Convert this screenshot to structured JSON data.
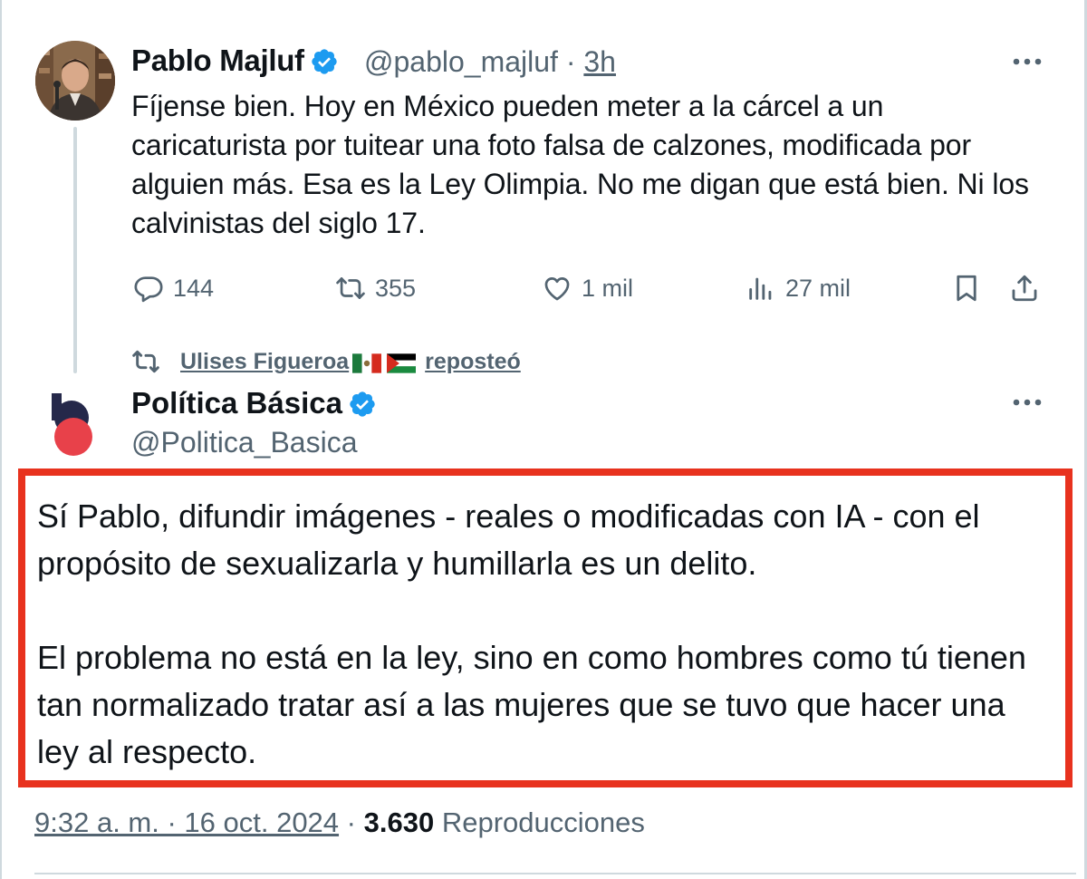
{
  "tweet1": {
    "display_name": "Pablo Majluf",
    "handle": "@pablo_majluf",
    "separator": "·",
    "time": "3h",
    "text": "Fíjense bien. Hoy en México pueden meter a la cárcel a un caricaturista por tuitear una foto falsa de calzones, modificada por alguien más. Esa es la Ley Olimpia. No me digan que está bien. Ni los calvinistas del siglo 17.",
    "replies": "144",
    "reposts": "355",
    "likes": "1 mil",
    "views": "27 mil"
  },
  "repost_note": {
    "user": "Ulises Figueroa",
    "action": "reposteó",
    "flags": [
      "mexico-flag",
      "palestine-flag"
    ]
  },
  "tweet2": {
    "display_name": "Política Básica",
    "handle": "@Politica_Basica",
    "paragraph1": "Sí Pablo, difundir imágenes - reales o modificadas con IA - con el propósito de sexualizarla y humillarla es un delito.",
    "paragraph2": "El problema no está en la ley, sino en como hombres como tú tienen tan normalizado tratar así a las mujeres que se tuvo que hacer una ley al respecto."
  },
  "meta": {
    "timestamp": "9:32 a. m. · 16 oct. 2024",
    "separator": "·",
    "view_count": "3.630",
    "views_label": "Reproducciones"
  },
  "colors": {
    "text": "#0f1419",
    "secondary": "#536471",
    "verified_blue": "#1d9bf0",
    "highlight_red": "#e8321e",
    "brand_navy": "#25284a",
    "brand_red": "#e8414a"
  }
}
